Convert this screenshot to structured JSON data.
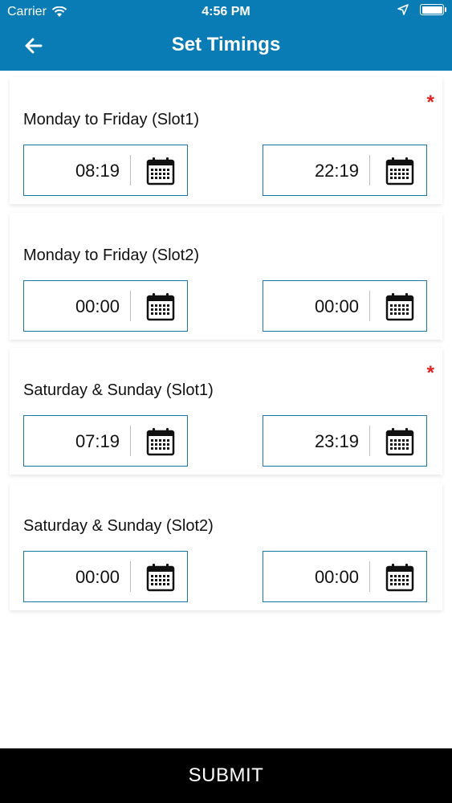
{
  "status_bar": {
    "carrier": "Carrier",
    "time": "4:56 PM",
    "icons": [
      "wifi-icon",
      "location-arrow-icon",
      "battery-icon"
    ]
  },
  "header": {
    "title": "Set Timings",
    "back_icon": "arrow-left-icon",
    "background_color": "#0a7cb5"
  },
  "slots": [
    {
      "title": "Monday to Friday (Slot1)",
      "required": "*",
      "start": "08:19",
      "end": "22:19"
    },
    {
      "title": "Monday to Friday (Slot2)",
      "required": "",
      "start": "00:00",
      "end": "00:00"
    },
    {
      "title": "Saturday & Sunday (Slot1)",
      "required": "*",
      "start": "07:19",
      "end": "23:19"
    },
    {
      "title": "Saturday & Sunday (Slot2)",
      "required": "",
      "start": "00:00",
      "end": "00:00"
    }
  ],
  "submit_label": "SUBMIT",
  "colors": {
    "accent": "#0a7cb5",
    "field_border": "#1778a8",
    "required_star": "#e02020",
    "submit_bg": "#000000"
  }
}
